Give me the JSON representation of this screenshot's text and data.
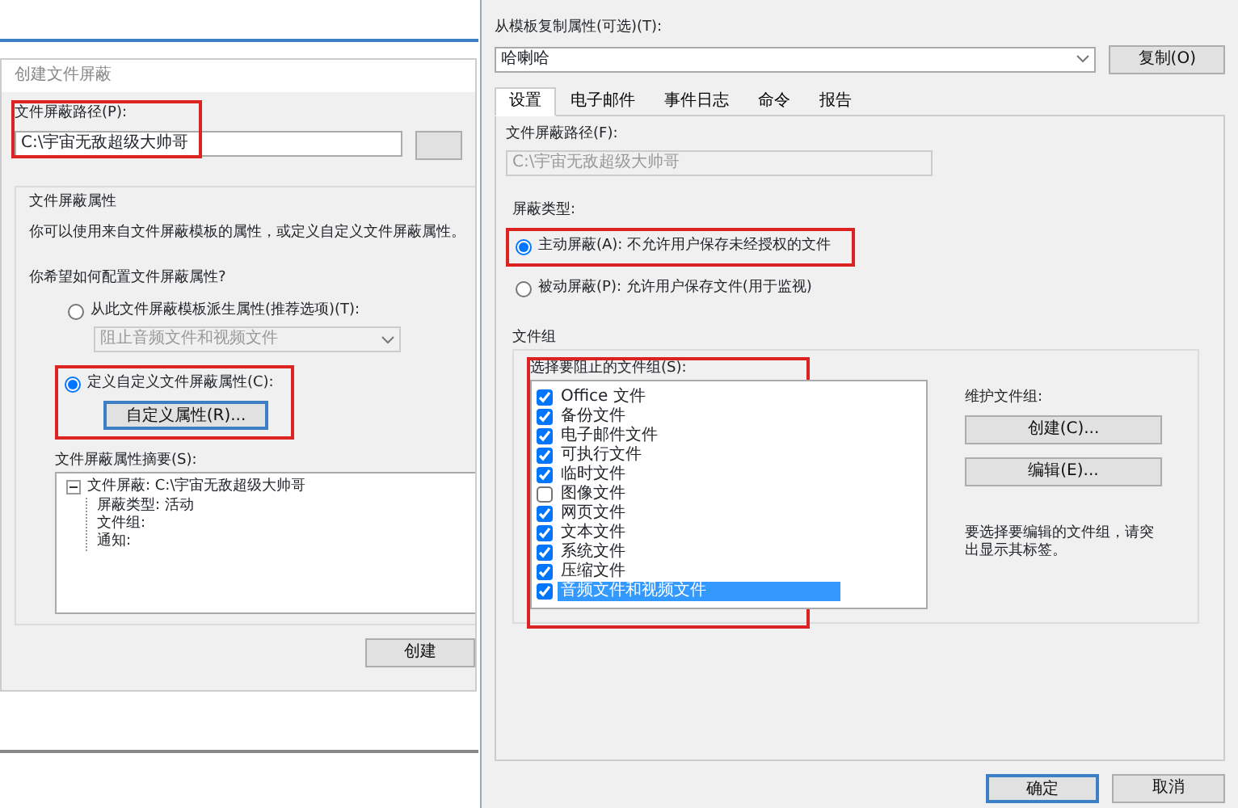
{
  "left_dialog": {
    "title": "创建文件屏蔽",
    "path_label": "文件屏蔽路径(P):",
    "path_value": "C:\\宇宙无敌超级大帅哥",
    "path_highlighted": true,
    "properties": {
      "title": "文件屏蔽属性",
      "description": "你可以使用来自文件屏蔽模板的属性，或定义自定义文件屏蔽属性。",
      "question": "你希望如何配置文件屏蔽属性?",
      "options": [
        {
          "label": "从此文件屏蔽模板派生属性(推荐选项)(T):",
          "selected": false,
          "highlighted": false
        },
        {
          "label": "定义自定义文件屏蔽属性(C):",
          "selected": true,
          "highlighted": true
        }
      ],
      "template_value": "阻止音频文件和视频文件",
      "template_disabled": true,
      "custom_button": "自定义属性(R)...",
      "summary_label": "文件屏蔽属性摘要(S):",
      "summary_tree": {
        "label": "文件屏蔽: C:\\宇宙无敌超级大帅哥",
        "expanded": true,
        "children": [
          {
            "label": "屏蔽类型: 活动"
          },
          {
            "label": "文件组:"
          },
          {
            "label": "通知:"
          }
        ]
      }
    },
    "create_button": "创建"
  },
  "right_dialog": {
    "template_label": "从模板复制属性(可选)(T):",
    "template_value": "哈喇哈",
    "copy_button": "复制(O)",
    "tabs": [
      {
        "label": "设置",
        "selected": true
      },
      {
        "label": "电子邮件",
        "selected": false
      },
      {
        "label": "事件日志",
        "selected": false
      },
      {
        "label": "命令",
        "selected": false
      },
      {
        "label": "报告",
        "selected": false
      }
    ],
    "path_label": "文件屏蔽路径(F):",
    "path_value": "C:\\宇宙无敌超级大帅哥",
    "path_disabled": true,
    "screen_type_label": "屏蔽类型:",
    "screen_types": [
      {
        "label": "主动屏蔽(A): 不允许用户保存未经授权的文件",
        "selected": true,
        "highlighted": true
      },
      {
        "label": "被动屏蔽(P): 允许用户保存文件(用于监视)",
        "selected": false,
        "highlighted": false
      }
    ],
    "file_groups_title": "文件组",
    "file_groups_label": "选择要阻止的文件组(S):",
    "file_groups_highlighted": true,
    "file_groups": [
      {
        "label": "Office 文件",
        "checked": true,
        "selected": false
      },
      {
        "label": "备份文件",
        "checked": true,
        "selected": false
      },
      {
        "label": "电子邮件文件",
        "checked": true,
        "selected": false
      },
      {
        "label": "可执行文件",
        "checked": true,
        "selected": false
      },
      {
        "label": "临时文件",
        "checked": true,
        "selected": false
      },
      {
        "label": "图像文件",
        "checked": false,
        "selected": false
      },
      {
        "label": "网页文件",
        "checked": true,
        "selected": false
      },
      {
        "label": "文本文件",
        "checked": true,
        "selected": false
      },
      {
        "label": "系统文件",
        "checked": true,
        "selected": false
      },
      {
        "label": "压缩文件",
        "checked": true,
        "selected": false
      },
      {
        "label": "音频文件和视频文件",
        "checked": true,
        "selected": true
      }
    ],
    "maintain_label": "维护文件组:",
    "create_button": "创建(C)...",
    "edit_button": "编辑(E)...",
    "hint": "要选择要编辑的文件组，请突出显示其标签。",
    "ok_button": "确定",
    "cancel_button": "取消"
  }
}
